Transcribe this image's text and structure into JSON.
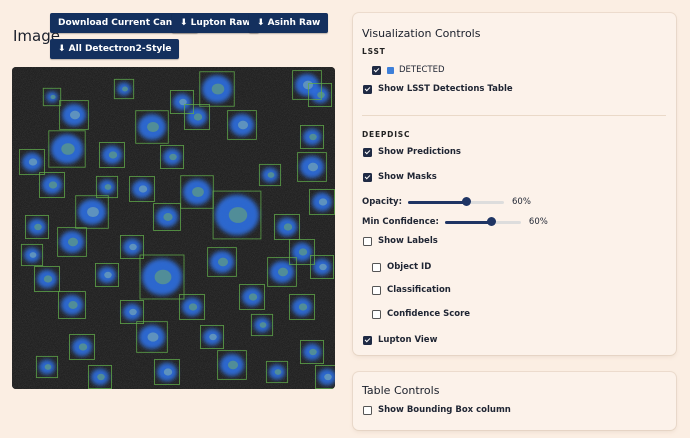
{
  "image_panel": {
    "title": "Image",
    "buttons": {
      "download_canvas": "Download Current Canvas",
      "lupton_raw": "⬇ Lupton Raw",
      "asinh_raw": "⬇ Asinh Raw",
      "all_detectron": "⬇ All Detectron2-Style"
    }
  },
  "viz_controls": {
    "title": "Visualization Controls",
    "lsst": {
      "heading": "LSST",
      "detected_label": "DETECTED",
      "detected_checked": true,
      "detected_color": "#3d7fd9",
      "show_table_label": "Show LSST Detections Table",
      "show_table_checked": true
    },
    "deepdisc": {
      "heading": "DEEPDISC",
      "show_predictions_label": "Show Predictions",
      "show_predictions_checked": true,
      "show_masks_label": "Show Masks",
      "show_masks_checked": true,
      "opacity_label": "Opacity:",
      "opacity_value": 0.6,
      "opacity_text": "60%",
      "min_conf_label": "Min Confidence:",
      "min_conf_value": 0.6,
      "min_conf_text": "60%",
      "show_labels_label": "Show Labels",
      "show_labels_checked": false,
      "object_id_label": "Object ID",
      "object_id_checked": false,
      "classification_label": "Classification",
      "classification_checked": false,
      "confidence_score_label": "Confidence Score",
      "confidence_score_checked": false,
      "lupton_view_label": "Lupton View",
      "lupton_view_checked": true
    }
  },
  "table_controls": {
    "title": "Table Controls",
    "bbox_label": "Show Bounding Box column",
    "bbox_checked": false
  },
  "colors": {
    "button": "#14305e",
    "mask": "#2f6fe0",
    "bbox": "#5fa84a",
    "background": "#fbeee3"
  }
}
